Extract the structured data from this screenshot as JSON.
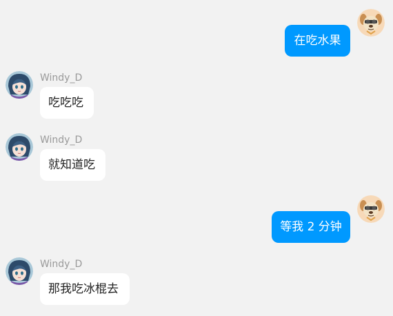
{
  "messages": [
    {
      "side": "right",
      "avatar": "dog-avatar-icon",
      "text": "在吃水果"
    },
    {
      "side": "left",
      "sender": "Windy_D",
      "avatar": "anime-girl-avatar-icon",
      "text": "吃吃吃"
    },
    {
      "side": "left",
      "sender": "Windy_D",
      "avatar": "anime-girl-avatar-icon",
      "text": "就知道吃"
    },
    {
      "side": "right",
      "avatar": "dog-avatar-icon",
      "text": "等我 2 分钟"
    },
    {
      "side": "left",
      "sender": "Windy_D",
      "avatar": "anime-girl-avatar-icon",
      "text": "那我吃冰棍去"
    }
  ],
  "colors": {
    "background": "#f2f2f2",
    "self_bubble": "#0099ff",
    "other_bubble": "#ffffff",
    "sender_name": "#999999"
  }
}
